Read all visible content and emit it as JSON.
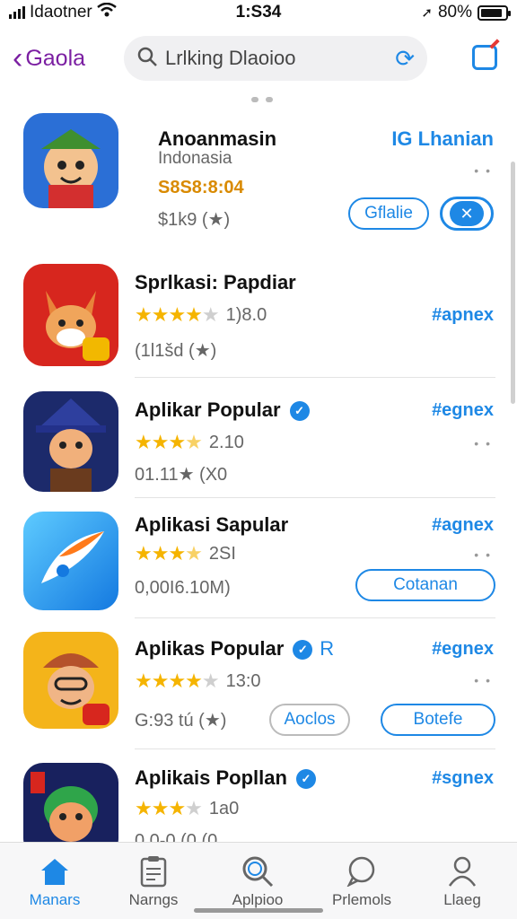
{
  "status": {
    "carrier": "Idaotner",
    "time": "1:S34",
    "battery": "80%"
  },
  "nav": {
    "back_label": "Gaola",
    "search_text": "Lrlking Dlaoioo"
  },
  "list": [
    {
      "title": "Anoanmasin",
      "subtitle": "Indonasia",
      "price": "S8S8:8:04",
      "meta": "$1k9 (★)",
      "tag": "IG Lhanian",
      "button": "Gflalie",
      "toggle": "✕"
    },
    {
      "title": "Sprlkasi: Papdiar",
      "rating": "1)8.0",
      "meta": "(1l1šd (★)",
      "tag": "#apnex"
    },
    {
      "title": "Aplikar Popular",
      "rating": "2.10",
      "meta": "01.11★ (X0",
      "tag": "#egnex"
    },
    {
      "title": "Aplikasi Sapular",
      "rating": "2SI",
      "meta": "0,00I6.10M)",
      "tag": "#agnex",
      "button": "Cotanan"
    },
    {
      "title": "Aplikas Popular",
      "extra": "R",
      "rating": "13:0",
      "meta": "G:93 tú (★)",
      "tag": "#egnex",
      "button": "Aoclos",
      "button2": "Botefe"
    },
    {
      "title": "Aplikais Popllan",
      "rating": "1a0",
      "meta": "0.0-0 (0 (0",
      "tag": "#sgnex"
    }
  ],
  "tabs": [
    {
      "label": "Manars"
    },
    {
      "label": "Narngs"
    },
    {
      "label": "Aplpioo"
    },
    {
      "label": "Prlemols"
    },
    {
      "label": "Llaeg"
    }
  ],
  "colors": {
    "accent": "#1e88e5",
    "back": "#7b1fa2",
    "star": "#f5b400"
  }
}
